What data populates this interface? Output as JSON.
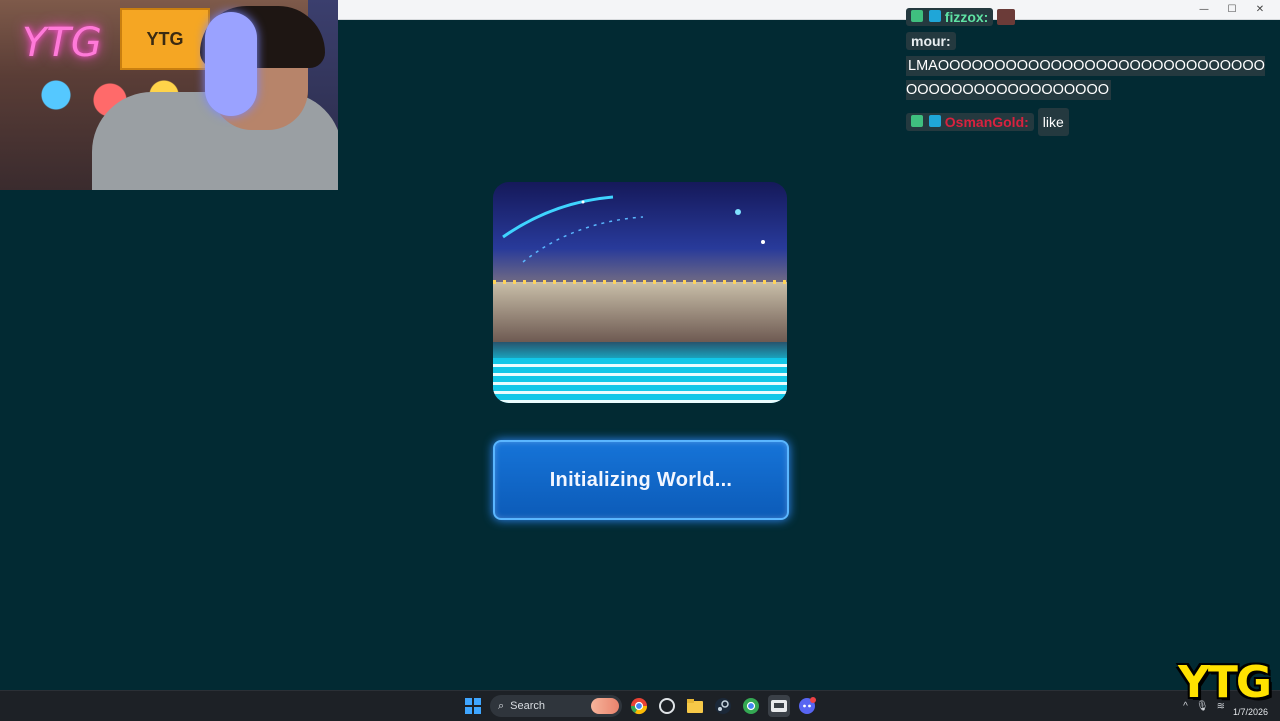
{
  "window": {
    "controls": [
      "—",
      "☐",
      "✕"
    ]
  },
  "webcam": {
    "neon_sign": "YTG",
    "flag_text": "YTG"
  },
  "chat": {
    "messages": [
      {
        "user": "fizzox:",
        "text": ""
      },
      {
        "user": "mour:",
        "text": "LMAOOOOOOOOOOOOOOOOOOOOOOOOOOOOOOOOOOOOOOOOOOOOOOO"
      },
      {
        "user": "OsmanGold:",
        "text": "like"
      }
    ]
  },
  "main": {
    "status_button_label": "Initializing World..."
  },
  "taskbar": {
    "search_label": "Search",
    "date": "1/7/2026"
  },
  "overlay": {
    "logo": "YTG"
  },
  "colors": {
    "background": "#022a33",
    "button": "#1674d8",
    "chat_user_a": "#5fe3a4",
    "chat_user_c": "#d8223f",
    "logo": "#ffe100"
  }
}
